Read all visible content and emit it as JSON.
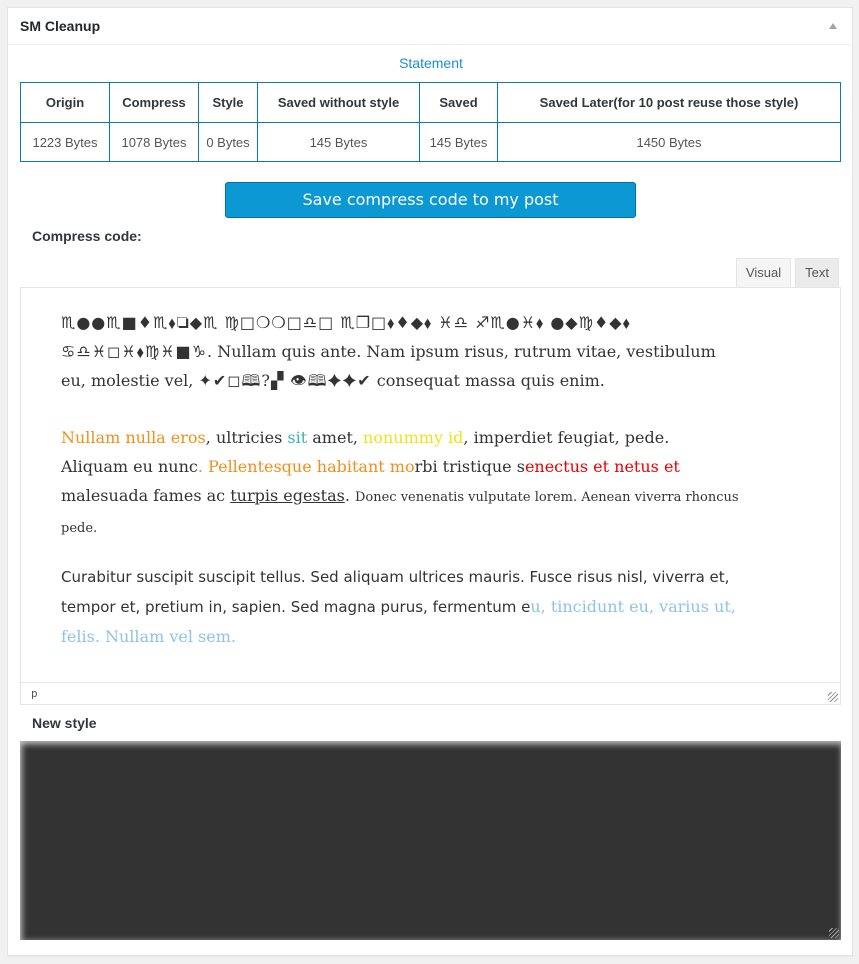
{
  "postbox": {
    "title": "SM Cleanup"
  },
  "statement": {
    "title": "Statement",
    "headers": [
      "Origin",
      "Compress",
      "Style",
      "Saved without style",
      "Saved",
      "Saved Later(for 10 post reuse those style)"
    ],
    "values": [
      "1223 Bytes",
      "1078 Bytes",
      "0 Bytes",
      "145 Bytes",
      "145 Bytes",
      "1450 Bytes"
    ]
  },
  "save_button": {
    "label": "Save compress code to my post"
  },
  "compress_code": {
    "label": "Compress code:",
    "tabs": [
      {
        "label": "Visual",
        "active": true
      },
      {
        "label": "Text",
        "active": false
      }
    ],
    "para1": {
      "symbols": "♏︎●●♏︎■♦♏︎⬧︎❏◆♏︎ ♍︎□❍❍□♎︎□ ♏︎❐□⬧︎♦◆⬧︎ ♓︎♎︎ ♐︎♏︎●♓︎⬧︎ ●◆♍︎♦◆⬧︎ ♋︎♎︎♓︎◻︎♓︎⬧︎♍︎♓︎■♑︎",
      "text1": ". Nullam quis ante. Nam ipsum risus, rutrum vitae, vestibulum eu, molestie vel, ",
      "symbols2": "✦✔︎◻︎🕮?▞ 👁🕮✦✦✔︎",
      "text2": " consequat massa quis enim."
    },
    "para2": {
      "s1": "Nullam nulla eros",
      "s2": ", ultricies ",
      "s3": "sit",
      "s4": " amet, ",
      "s5": "nonummy id",
      "s6": ", imperdiet feugiat, pede. Aliquam eu nunc",
      "s7": ". Pellentesque habitant mo",
      "s8": "rbi tristique s",
      "s9": "enectus et netus et",
      "s10": " malesuada fames ac ",
      "s11": "turpis egestas",
      "s12": ". ",
      "s13": "Donec venenatis vulputate lorem. Aenean viverra rhoncus pede."
    },
    "para3": {
      "s1": "Curabitur suscipit suscipit tellus. Sed aliquam ultrices mauris. Fusce risus nisl, viverra et, tempor et, pretium in, sapien. Sed magna purus, fermentum e",
      "s2": "u, tincidunt eu, varius ut, felis. Nullam vel sem."
    },
    "status_path": "p"
  },
  "new_style": {
    "label": "New style"
  },
  "colors": {
    "accent": "#0c98d2",
    "link_blue": "#1a8fce",
    "orange": "#f0901a",
    "teal": "#3fb3b5",
    "yellow": "#f0e21a",
    "red": "#e00000",
    "light_blue": "#8ec3e8",
    "style_box": "#333333"
  }
}
